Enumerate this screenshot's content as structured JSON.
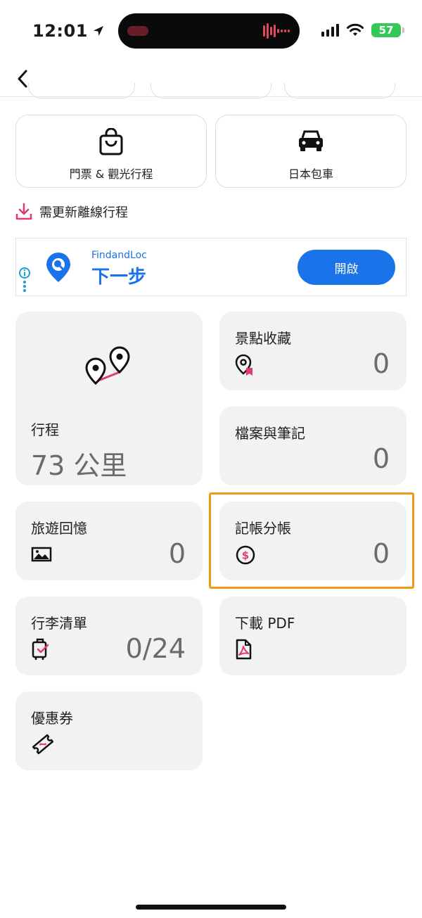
{
  "status_bar": {
    "time": "12:01",
    "battery": "57"
  },
  "tiles": [
    {
      "label": "門票 & 觀光行程",
      "icon": "shopping-bag-icon"
    },
    {
      "label": "日本包車",
      "icon": "car-icon"
    }
  ],
  "offline_label": "需更新離線行程",
  "ad": {
    "app_name": "FindandLoc",
    "headline": "下一步",
    "button_label": "開啟"
  },
  "cards": {
    "itinerary": {
      "title": "行程",
      "value": "73 公里",
      "icon": "route-pins-icon"
    },
    "saved_spots": {
      "title": "景點收藏",
      "count": "0",
      "icon": "location-bookmark-icon"
    },
    "files_notes": {
      "title": "檔案與筆記",
      "count": "0"
    },
    "memories": {
      "title": "旅遊回憶",
      "count": "0",
      "icon": "image-icon"
    },
    "expenses": {
      "title": "記帳分帳",
      "count": "0",
      "icon": "dollar-coin-icon"
    },
    "packing": {
      "title": "行李清單",
      "count": "0/24",
      "icon": "luggage-check-icon"
    },
    "download_pdf": {
      "title": "下載 PDF",
      "icon": "pdf-file-icon"
    },
    "coupons": {
      "title": "優惠券",
      "icon": "coupon-ticket-icon"
    }
  },
  "colors": {
    "accent_pink": "#e33a6d",
    "ad_blue": "#1a73e8",
    "highlight_orange": "#f29a12",
    "card_bg": "#f2f2f2"
  }
}
